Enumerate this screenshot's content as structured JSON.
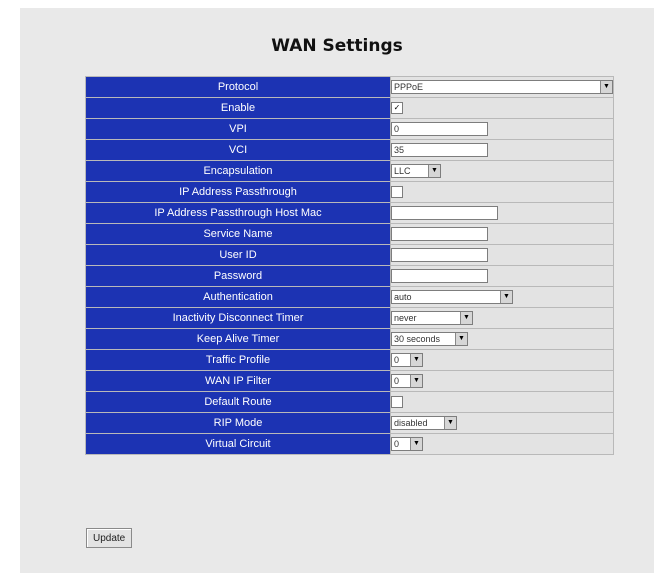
{
  "title": "WAN Settings",
  "rows": [
    {
      "label": "Protocol",
      "type": "select",
      "value": "PPPoE",
      "w": 222
    },
    {
      "label": "Enable",
      "type": "checkbox",
      "checked": true
    },
    {
      "label": "VPI",
      "type": "text",
      "value": "0",
      "w": 97
    },
    {
      "label": "VCI",
      "type": "text",
      "value": "35",
      "w": 97
    },
    {
      "label": "Encapsulation",
      "type": "select",
      "value": "LLC",
      "w": 50
    },
    {
      "label": "IP Address Passthrough",
      "type": "checkbox",
      "checked": false
    },
    {
      "label": "IP Address Passthrough Host Mac",
      "type": "text",
      "value": "",
      "w": 107
    },
    {
      "label": "Service Name",
      "type": "text",
      "value": "",
      "w": 97
    },
    {
      "label": "User ID",
      "type": "text",
      "value": "",
      "w": 97
    },
    {
      "label": "Password",
      "type": "text",
      "value": "",
      "w": 97
    },
    {
      "label": "Authentication",
      "type": "select",
      "value": "auto",
      "w": 122
    },
    {
      "label": "Inactivity Disconnect Timer",
      "type": "select",
      "value": "never",
      "w": 82
    },
    {
      "label": "Keep Alive Timer",
      "type": "select",
      "value": "30 seconds",
      "w": 77
    },
    {
      "label": "Traffic Profile",
      "type": "select",
      "value": "0",
      "w": 32
    },
    {
      "label": "WAN IP Filter",
      "type": "select",
      "value": "0",
      "w": 32
    },
    {
      "label": "Default Route",
      "type": "checkbox",
      "checked": false
    },
    {
      "label": "RIP Mode",
      "type": "select",
      "value": "disabled",
      "w": 66
    },
    {
      "label": "Virtual Circuit",
      "type": "select",
      "value": "0",
      "w": 32
    }
  ],
  "update_label": "Update"
}
